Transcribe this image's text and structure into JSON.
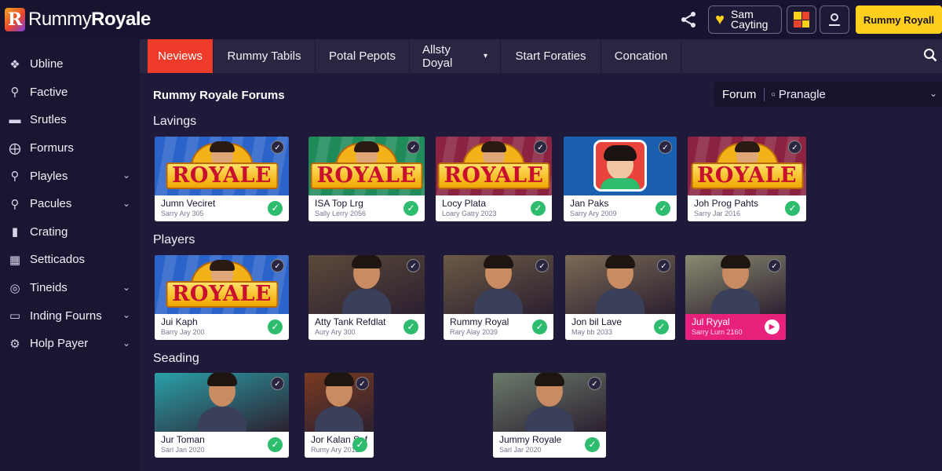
{
  "header": {
    "logo_letter": "R",
    "logo_prefix": "Rummy",
    "logo_bold": "Royale",
    "user_name": "Sam Cayting",
    "cta_label": "Rummy Royall"
  },
  "sidebar": {
    "items": [
      {
        "label": "Ubline",
        "icon": "puzzle-icon",
        "chevron": false
      },
      {
        "label": "Factive",
        "icon": "key-icon",
        "chevron": false
      },
      {
        "label": "Srutles",
        "icon": "layers-icon",
        "chevron": false
      },
      {
        "label": "Formurs",
        "icon": "globe-icon",
        "chevron": false
      },
      {
        "label": "Playles",
        "icon": "search-icon",
        "chevron": true
      },
      {
        "label": "Pacules",
        "icon": "user-search-icon",
        "chevron": true
      },
      {
        "label": "Crating",
        "icon": "document-icon",
        "chevron": false
      },
      {
        "label": "Setticados",
        "icon": "grid-book-icon",
        "chevron": false
      },
      {
        "label": "Tineids",
        "icon": "target-icon",
        "chevron": true
      },
      {
        "label": "Inding Fourns",
        "icon": "monitor-icon",
        "chevron": true
      },
      {
        "label": "Holp Payer",
        "icon": "gear-icon",
        "chevron": true
      }
    ]
  },
  "tabs": [
    {
      "label": "Neviews",
      "active": true
    },
    {
      "label": "Rummy Tabils",
      "active": false
    },
    {
      "label": "Potal Pepots",
      "active": false
    },
    {
      "label": "Allsty Doyal",
      "active": false,
      "dropdown": true
    },
    {
      "label": "Start Foraties",
      "active": false
    },
    {
      "label": "Concation",
      "active": false
    }
  ],
  "page": {
    "title": "Rummy Royale Forums",
    "forum_label": "Forum",
    "forum_value": "Pranagle"
  },
  "sections": [
    {
      "title": "Lavings",
      "cards": [
        {
          "title": "Jumn Veciret",
          "date": "Sarry Ary 305",
          "art": "royale",
          "bg": "#2a63c9",
          "ok": "check"
        },
        {
          "title": "ISA Top Lrg",
          "date": "Sally Lerry 2056",
          "art": "royale",
          "bg": "#1f8a5a",
          "ok": "check"
        },
        {
          "title": "Locy Plata",
          "date": "Loary Gatry 2023",
          "art": "royale",
          "bg": "#8a2240",
          "ok": "check"
        },
        {
          "title": "Jan Paks",
          "date": "Sarry Ary 2009",
          "art": "avatar",
          "bg": "#1b5fb0",
          "ok": "check"
        },
        {
          "title": "Joh Prog Pahts",
          "date": "Sarry Jar 2016",
          "art": "royale",
          "bg": "#8a2240",
          "ok": "check"
        }
      ]
    },
    {
      "title": "Players",
      "cards": [
        {
          "title": "Jui Kaph",
          "date": "Barry Jay 200",
          "art": "royale",
          "bg": "#2a63c9",
          "ok": "check"
        },
        {
          "title": "Atty Tank Refdlat",
          "date": "Aury Ary 300",
          "art": "photo",
          "bg": "#5b4a3a",
          "ok": "check"
        },
        {
          "title": "Rummy Royal",
          "date": "Rary Alay 2039",
          "art": "photo",
          "bg": "#6b5a45",
          "ok": "check"
        },
        {
          "title": "Jon bil Lave",
          "date": "May bb 2033",
          "art": "photo",
          "bg": "#7a6a55",
          "ok": "check"
        },
        {
          "title": "Jul Ryyal",
          "date": "Sarry Lurn 2160",
          "art": "photo",
          "bg": "#8a8a70",
          "ok": "play",
          "pink": true
        }
      ]
    },
    {
      "title": "Seading",
      "cards": [
        {
          "title": "Jur Toman",
          "date": "Sarl Jan 2020",
          "art": "photo",
          "bg": "#2aa0a8",
          "ok": "check"
        },
        {
          "title": "Jor Kalan Sef",
          "date": "Rumy Ary 2012",
          "art": "photo",
          "bg": "#7a3a20",
          "ok": "check"
        },
        {
          "title": "Jummy Royale",
          "date": "Sarl Jar 2020",
          "art": "photo",
          "bg": "#6a7a6a",
          "ok": "check"
        }
      ]
    }
  ],
  "colors": {
    "accent_red": "#ef3b2a",
    "cta_yellow": "#ffcf1d",
    "ok_green": "#2ebd6f",
    "pink": "#e8217d"
  }
}
